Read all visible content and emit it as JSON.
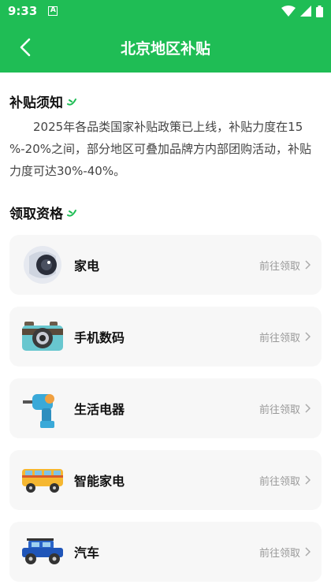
{
  "status": {
    "time": "9:33",
    "badge": "A"
  },
  "header": {
    "title": "北京地区补贴"
  },
  "notice": {
    "title": "补贴须知",
    "body": "2025年各品类国家补贴政策已上线，补贴力度在15 %-20%之间，部分地区可叠加品牌方内部团购活动，补贴力度可达30%-40%。"
  },
  "eligibility": {
    "title": "领取资格",
    "items": [
      {
        "label": "家电",
        "action": "前往领取",
        "icon": "speaker-icon"
      },
      {
        "label": "手机数码",
        "action": "前往领取",
        "icon": "camera-icon"
      },
      {
        "label": "生活电器",
        "action": "前往领取",
        "icon": "drill-icon"
      },
      {
        "label": "智能家电",
        "action": "前往领取",
        "icon": "bus-icon"
      },
      {
        "label": "汽车",
        "action": "前往领取",
        "icon": "jeep-icon"
      }
    ]
  },
  "colors": {
    "brand": "#1fbd55",
    "card_bg": "#f7f7f7"
  }
}
